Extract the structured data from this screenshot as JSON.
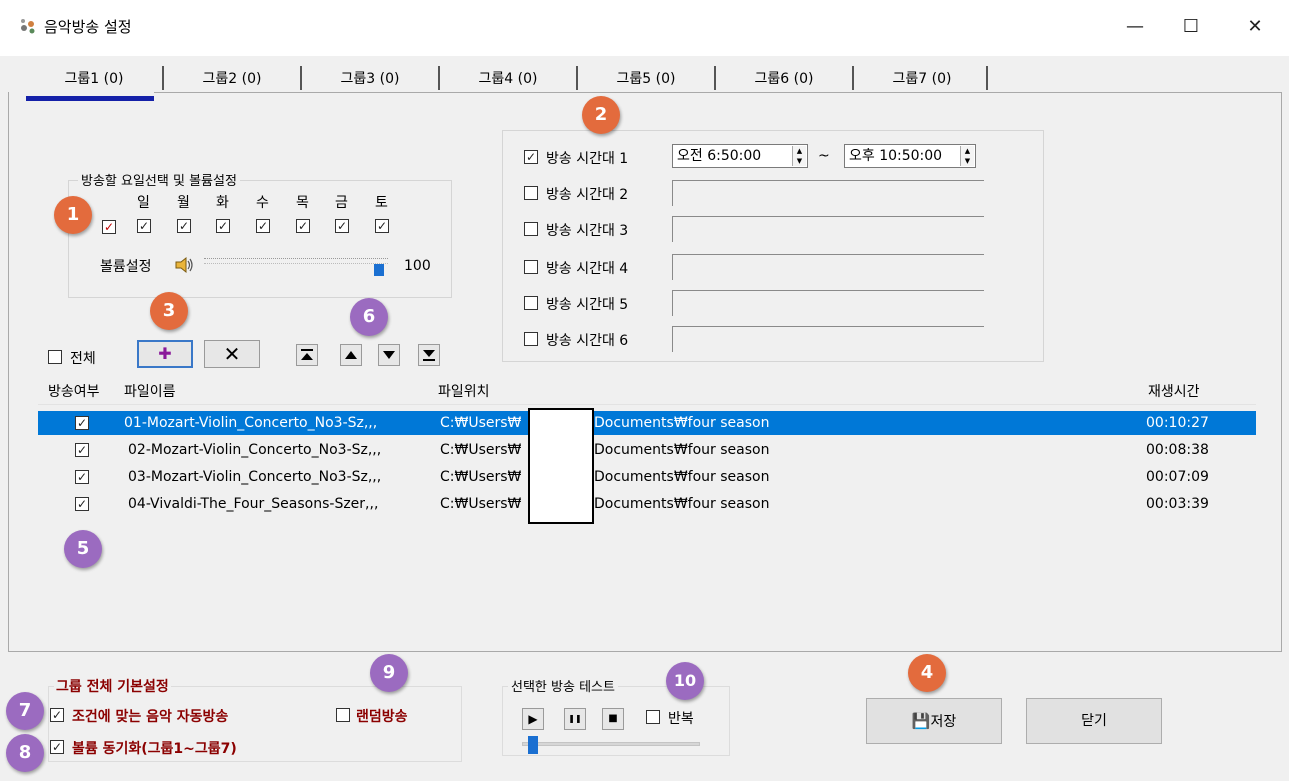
{
  "window": {
    "title": "음악방송 설정",
    "minimize": "—",
    "maximize": "☐",
    "close": "✕"
  },
  "tabs": [
    {
      "label": "그룹1 (0)",
      "active": true
    },
    {
      "label": "그룹2 (0)"
    },
    {
      "label": "그룹3 (0)"
    },
    {
      "label": "그룹4 (0)"
    },
    {
      "label": "그룹5 (0)"
    },
    {
      "label": "그룹6 (0)"
    },
    {
      "label": "그룹7 (0)"
    }
  ],
  "days_group": {
    "title": "방송할 요일선택 및 볼륨설정",
    "days": [
      "일",
      "월",
      "화",
      "수",
      "목",
      "금",
      "토"
    ],
    "all_checked": true,
    "volume_label": "볼륨설정",
    "volume_value": "100",
    "volume_level": 1.0
  },
  "time_slots": [
    {
      "label": "방송 시간대 1",
      "checked": true,
      "start": "오전  6:50:00",
      "sep": "~",
      "end": "오후 10:50:00"
    },
    {
      "label": "방송 시간대 2",
      "checked": false
    },
    {
      "label": "방송 시간대 3",
      "checked": false
    },
    {
      "label": "방송 시간대 4",
      "checked": false
    },
    {
      "label": "방송 시간대 5",
      "checked": false
    },
    {
      "label": "방송 시간대 6",
      "checked": false
    }
  ],
  "toolbar": {
    "all_label": "전체",
    "add_icon": "✚",
    "delete_icon": "✕"
  },
  "table": {
    "headers": [
      "방송여부",
      "파일이름",
      "파일위치",
      "재생시간"
    ],
    "rows": [
      {
        "name": "01-Mozart-Violin_Concerto_No3-Sz,,,",
        "path_a": "C:₩Users₩",
        "path_b": "Documents₩four season",
        "duration": "00:10:27",
        "selected": true
      },
      {
        "name": "02-Mozart-Violin_Concerto_No3-Sz,,,",
        "path_a": "C:₩Users₩",
        "path_b": "Documents₩four season",
        "duration": "00:08:38"
      },
      {
        "name": "03-Mozart-Violin_Concerto_No3-Sz,,,",
        "path_a": "C:₩Users₩",
        "path_b": "Documents₩four season",
        "duration": "00:07:09"
      },
      {
        "name": "04-Vivaldi-The_Four_Seasons-Szer,,,",
        "path_a": "C:₩Users₩",
        "path_b": "Documents₩four season",
        "duration": "00:03:39"
      }
    ]
  },
  "group_settings": {
    "title": "그룹 전체 기본설정",
    "auto_play": "조건에 맞는 음악 자동방송",
    "random": "랜덤방송",
    "volume_sync": "볼륨 동기화(그룹1~그룹7)"
  },
  "test_group": {
    "title": "선택한 방송 테스트",
    "repeat": "반복",
    "play_icon": "▶",
    "pause_icon": "❚❚",
    "stop_icon": "■"
  },
  "buttons": {
    "save": "저장",
    "close": "닫기"
  },
  "badges": [
    "1",
    "2",
    "3",
    "4",
    "5",
    "6",
    "7",
    "8",
    "9",
    "10"
  ],
  "colors": {
    "selection": "#0078d7",
    "tab_underline": "#1420a8",
    "badge_orange": "#e36b3d",
    "badge_purple": "#9b6bc0",
    "label_red": "#8b0000"
  }
}
